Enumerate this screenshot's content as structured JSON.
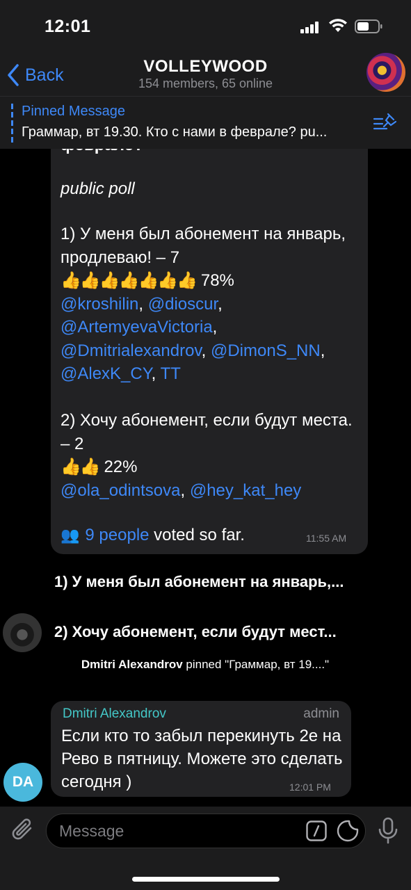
{
  "status": {
    "time": "12:01"
  },
  "header": {
    "back_label": "Back",
    "title": "VOLLEYWOOD",
    "subtitle": "154 members, 65 online"
  },
  "pinned": {
    "title": "Pinned Message",
    "text": "Граммар, вт 19.30. Кто с нами в феврале? pu..."
  },
  "poll": {
    "question_tail": "феврале?",
    "type": "public poll",
    "options": [
      {
        "text": "1) У меня был абонемент на январь, продлеваю! – 7",
        "thumbs": "👍👍👍👍👍👍👍",
        "percent": "78%",
        "voters": [
          "@kroshilin",
          "@dioscur",
          "@ArtemyevaVictoria",
          "@Dmitrialexandrov",
          "@DimonS_NN",
          "@AlexK_CY",
          "TT"
        ]
      },
      {
        "text": "2) Хочу абонемент, если будут места. – 2",
        "thumbs": "👍👍",
        "percent": "22%",
        "voters": [
          "@ola_odintsova",
          "@hey_kat_hey"
        ]
      }
    ],
    "voted_link": "9 people",
    "voted_text": " voted so far.",
    "time": "11:55 AM"
  },
  "messages": [
    {
      "text": "1) У меня был абонемент на январь,..."
    },
    {
      "text": "2) Хочу абонемент, если будут мест..."
    }
  ],
  "service": {
    "actor": "Dmitri Alexandrov",
    "text": " pinned \"Граммар, вт 19....\""
  },
  "last_message": {
    "sender": "Dmitri Alexandrov",
    "role": "admin",
    "avatar_initials": "DA",
    "text": "Если кто то забыл перекинуть 2е на Рево в пятницу. Можете это сделать сегодня )",
    "time": "12:01 PM"
  },
  "input": {
    "placeholder": "Message"
  },
  "colors": {
    "accent": "#3e88f7",
    "sender_name": "#44c8c8",
    "bubble": "#222224",
    "avatar_da": "#4ab8dc"
  }
}
